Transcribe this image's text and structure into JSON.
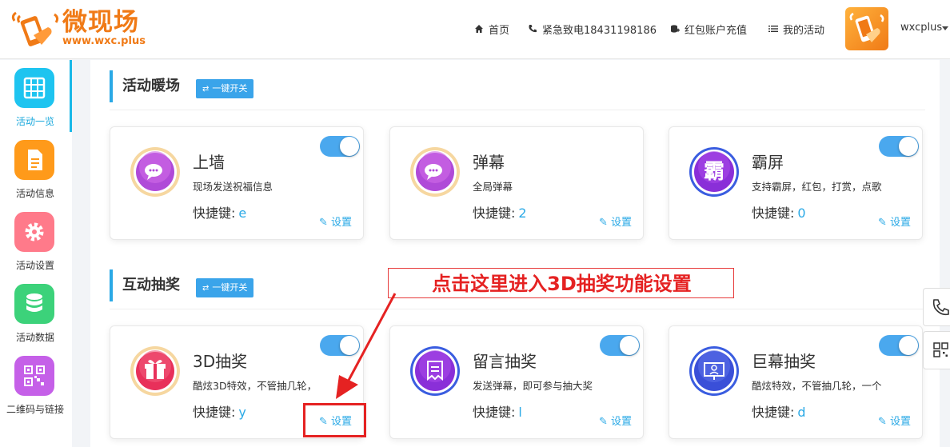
{
  "logo": {
    "title": "微现场",
    "url": "www.wxc.plus"
  },
  "nav": [
    {
      "label": "首页",
      "icon": "home-icon"
    },
    {
      "label": "紧急致电18431198186",
      "icon": "phone-icon"
    },
    {
      "label": "红包账户充值",
      "icon": "recharge-icon"
    },
    {
      "label": "我的活动",
      "icon": "list-icon"
    }
  ],
  "user": {
    "name": "wxcplus"
  },
  "sidebar": {
    "items": [
      {
        "label": "活动一览",
        "icon": "grid-icon",
        "color": "#1ec4f0"
      },
      {
        "label": "活动信息",
        "icon": "document-icon",
        "color": "#ff9a1a"
      },
      {
        "label": "活动设置",
        "icon": "gear-icon",
        "color": "#ff7a8a"
      },
      {
        "label": "活动数据",
        "icon": "database-icon",
        "color": "#3cd27a"
      },
      {
        "label": "二维码与链接",
        "icon": "qrcode-icon",
        "color": "#c560e8"
      }
    ]
  },
  "sections": [
    {
      "title": "活动暖场",
      "one_key": "一键开关",
      "cards": [
        {
          "title": "上墙",
          "desc": "现场发送祝福信息",
          "key_label": "快捷键:",
          "key": "e",
          "settings": "设置",
          "icon": "chat-bubble-icon",
          "enabled": true
        },
        {
          "title": "弹幕",
          "desc": "全局弹幕",
          "key_label": "快捷键:",
          "key": "2",
          "settings": "设置",
          "icon": "chat-bubble-icon",
          "enabled": false
        },
        {
          "title": "霸屏",
          "desc": "支持霸屏，红包，打赏，点歌",
          "key_label": "快捷键:",
          "key": "0",
          "settings": "设置",
          "icon": "ba-character-icon",
          "icon_char": "霸",
          "enabled": true
        }
      ]
    },
    {
      "title": "互动抽奖",
      "one_key": "一键开关",
      "cards": [
        {
          "title": "3D抽奖",
          "desc": "酷炫3D特效，不管抽几轮，",
          "key_label": "快捷键:",
          "key": "y",
          "settings": "设置",
          "icon": "gift-icon",
          "enabled": true
        },
        {
          "title": "留言抽奖",
          "desc": "发送弹幕，即可参与抽大奖",
          "key_label": "快捷键:",
          "key": "l",
          "settings": "设置",
          "icon": "message-note-icon",
          "enabled": true
        },
        {
          "title": "巨幕抽奖",
          "desc": "酷炫特效，不管抽几轮，一个",
          "key_label": "快捷键:",
          "key": "d",
          "settings": "设置",
          "icon": "big-screen-icon",
          "enabled": true
        }
      ]
    }
  ],
  "annotation": {
    "text": "点击这里进入3D抽奖功能设置",
    "color": "#e52222"
  },
  "colors": {
    "accent": "#2aa9e6",
    "brand": "#f07a16",
    "toggle_on": "#4aa8ee"
  }
}
